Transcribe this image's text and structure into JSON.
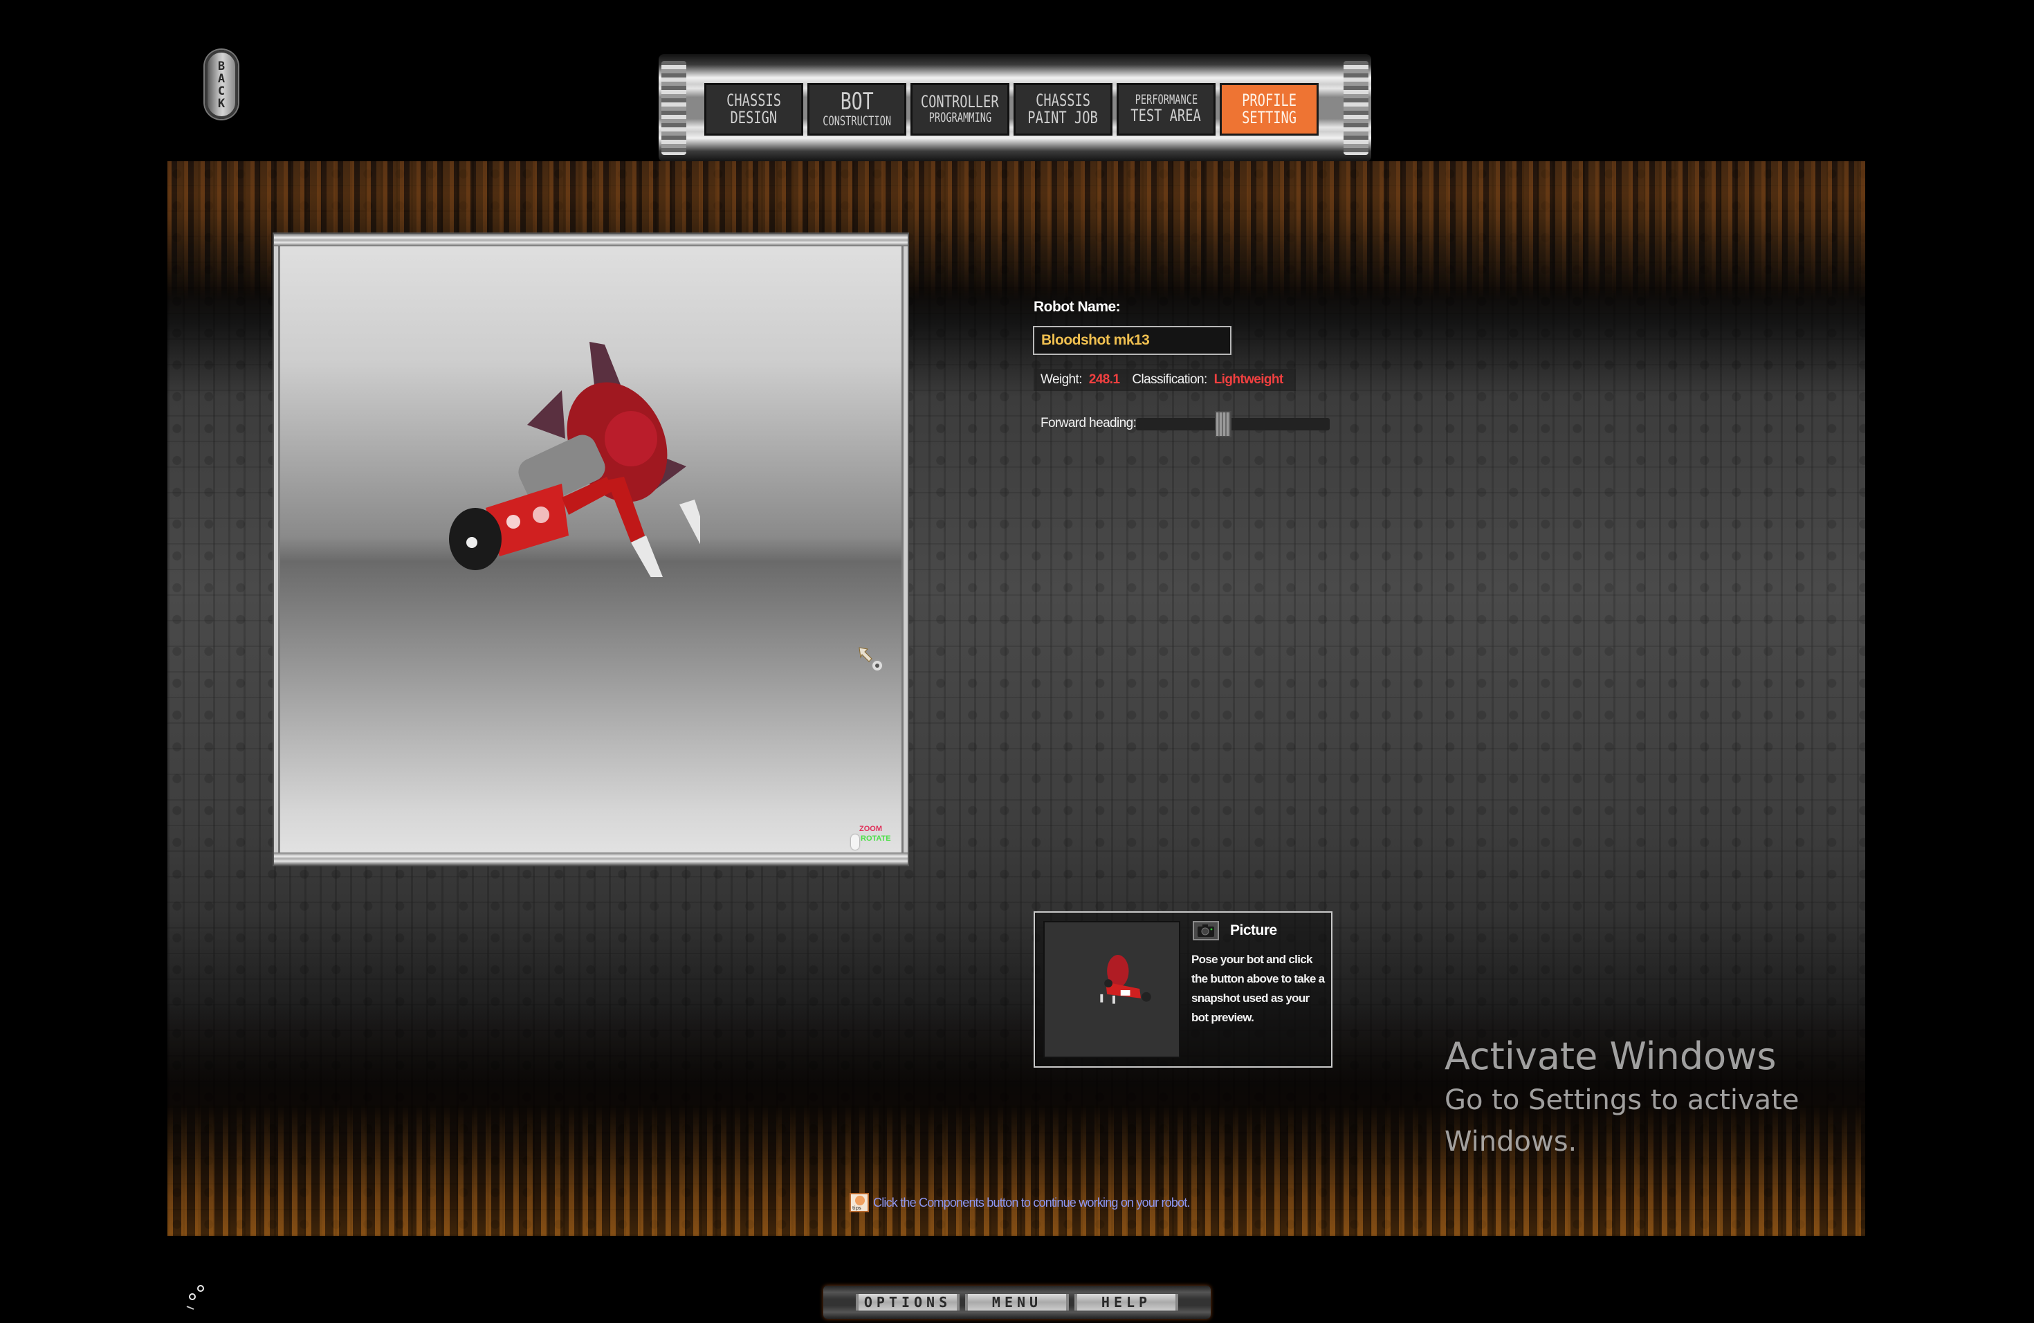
{
  "back_button": {
    "label": "BACK"
  },
  "topnav": {
    "tabs": [
      {
        "line1": "CHASSIS",
        "line2": "DESIGN",
        "active": false
      },
      {
        "line1": "BOT",
        "line2": "CONSTRUCTION",
        "active": false
      },
      {
        "line1": "CONTROLLER",
        "line2": "PROGRAMMING",
        "active": false
      },
      {
        "line1": "CHASSIS",
        "line2": "PAINT JOB",
        "active": false
      },
      {
        "line1": "PERFORMANCE",
        "line2": "TEST AREA",
        "active": false
      },
      {
        "line1": "PROFILE",
        "line2": "SETTING",
        "active": true
      }
    ],
    "active_color": "#ee7433"
  },
  "viewport": {
    "mouse_legend": {
      "zoom": "ZOOM",
      "rotate": "ROTATE"
    },
    "cursor_icon": "gear-arrow-cursor"
  },
  "profile": {
    "robot_name_label": "Robot Name:",
    "robot_name_value": "Bloodshot mk13",
    "weight_label": "Weight:",
    "weight_value": "248.1",
    "classification_label": "Classification:",
    "classification_value": "Lightweight",
    "forward_heading_label": "Forward heading:",
    "forward_heading_fraction": 0.45,
    "value_color": "#f04040",
    "name_color": "#f0c050"
  },
  "picture": {
    "title": "Picture",
    "description": "Pose your bot and click the button above to take a snapshot used as your bot preview.",
    "camera_icon": "camera-icon"
  },
  "tip": {
    "icon_label": "tips",
    "text": "Click the Components button to continue working on your robot."
  },
  "bottomnav": {
    "options": "OPTIONS",
    "menu": "MENU",
    "help": "HELP"
  },
  "watermark": {
    "title": "Activate Windows",
    "subtitle": "Go to Settings to activate Windows."
  }
}
